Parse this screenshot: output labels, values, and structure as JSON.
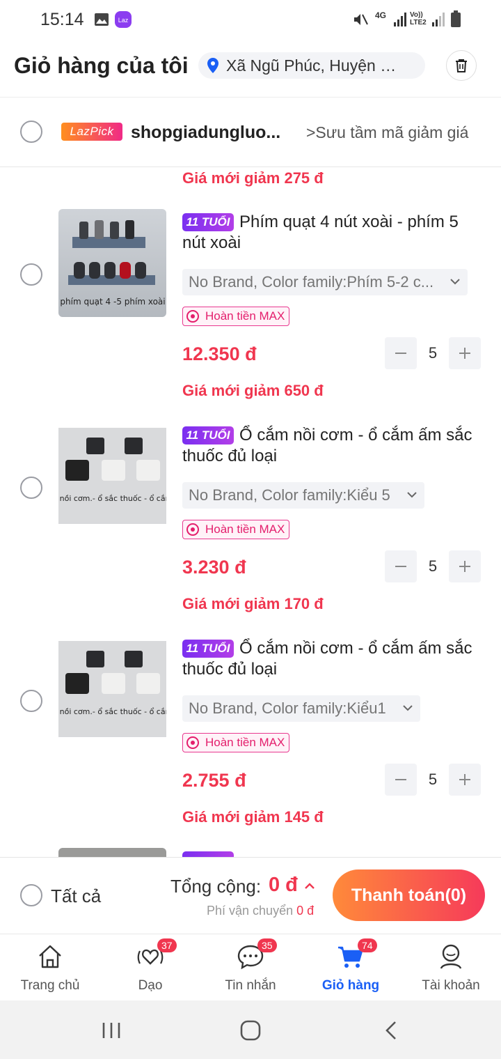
{
  "status_bar": {
    "time": "15:14",
    "network_label": "4G",
    "volte_label": "Vo)) LTE2"
  },
  "header": {
    "title": "Giỏ hàng của tôi",
    "address": "Xã Ngũ Phúc, Huyện Ki..."
  },
  "store": {
    "badge": "LazPick",
    "name": "shopgiadungluo...",
    "voucher_link": ">Sưu tầm mã giảm giá"
  },
  "prev_item_discount": "Giá mới giảm 275 đ",
  "items": [
    {
      "tag": "11 TUỔI",
      "title": "Phím quạt 4 nút xoài - phím 5 nút xoài",
      "thumb_caption": "phím quạt 4 -5 phím xoài",
      "variant": "No Brand, Color family:Phím 5-2 c...",
      "refund": "Hoàn tiền MAX",
      "price": "12.350 đ",
      "quantity": "5",
      "discount": "Giá mới giảm 650 đ"
    },
    {
      "tag": "11 TUỔI",
      "title": "Ổ cắm nồi cơm - ổ cắm ấm sắc thuốc đủ loại",
      "thumb_caption": "ổ cắm nồi cơm.- ổ sắc thuốc - ổ cắm điện",
      "variant": "No Brand, Color family:Kiểu 5",
      "refund": "Hoàn tiền MAX",
      "price": "3.230 đ",
      "quantity": "5",
      "discount": "Giá mới giảm 170 đ"
    },
    {
      "tag": "11 TUỔI",
      "title": "Ổ cắm nồi cơm - ổ cắm ấm sắc thuốc đủ loại",
      "thumb_caption": "ổ cắm nồi cơm.- ổ sắc thuốc - ổ cắm điện",
      "variant": "No Brand, Color family:Kiểu1",
      "refund": "Hoàn tiền MAX",
      "price": "2.755 đ",
      "quantity": "5",
      "discount": "Giá mới giảm 145 đ"
    }
  ],
  "checkout": {
    "select_all": "Tất cả",
    "total_label": "Tổng cộng:",
    "total_value": "0 đ",
    "shipping_label": "Phí vận chuyển",
    "shipping_value": "0 đ",
    "pay_button": "Thanh toán(0)"
  },
  "nav": [
    {
      "label": "Trang chủ",
      "icon": "home-icon"
    },
    {
      "label": "Dạo",
      "icon": "live-heart-icon",
      "count": "37"
    },
    {
      "label": "Tin nhắn",
      "icon": "chat-icon",
      "count": "35"
    },
    {
      "label": "Giỏ hàng",
      "icon": "cart-icon",
      "count": "74",
      "active": true
    },
    {
      "label": "Tài khoản",
      "icon": "account-icon"
    }
  ],
  "colors": {
    "accent_red": "#f0364f",
    "active_blue": "#1a5ff5",
    "pay_gradient": [
      "#ff8a3a",
      "#f63a5a"
    ],
    "tag_purple": "#7a2ff0"
  }
}
